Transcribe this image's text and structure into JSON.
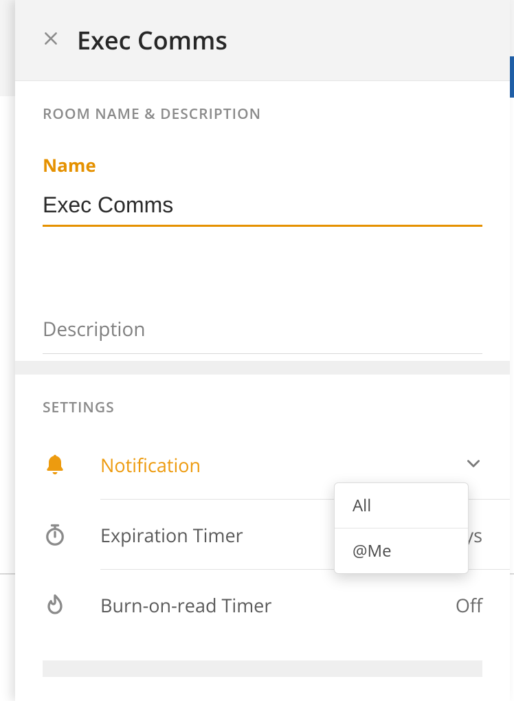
{
  "header": {
    "title": "Exec Comms"
  },
  "room_section": {
    "heading": "ROOM NAME & DESCRIPTION",
    "name_label": "Name",
    "name_value": "Exec Comms",
    "description_placeholder": "Description"
  },
  "settings_section": {
    "heading": "SETTINGS",
    "rows": {
      "notification": {
        "label": "Notification",
        "value": ""
      },
      "expiration": {
        "label": "Expiration Timer",
        "value": "365 Days"
      },
      "burn": {
        "label": "Burn-on-read Timer",
        "value": "Off"
      }
    }
  },
  "notification_dropdown": {
    "options": [
      "All",
      "@Me"
    ]
  },
  "colors": {
    "accent": "#e59100",
    "icon_active": "#ed9b0f"
  }
}
